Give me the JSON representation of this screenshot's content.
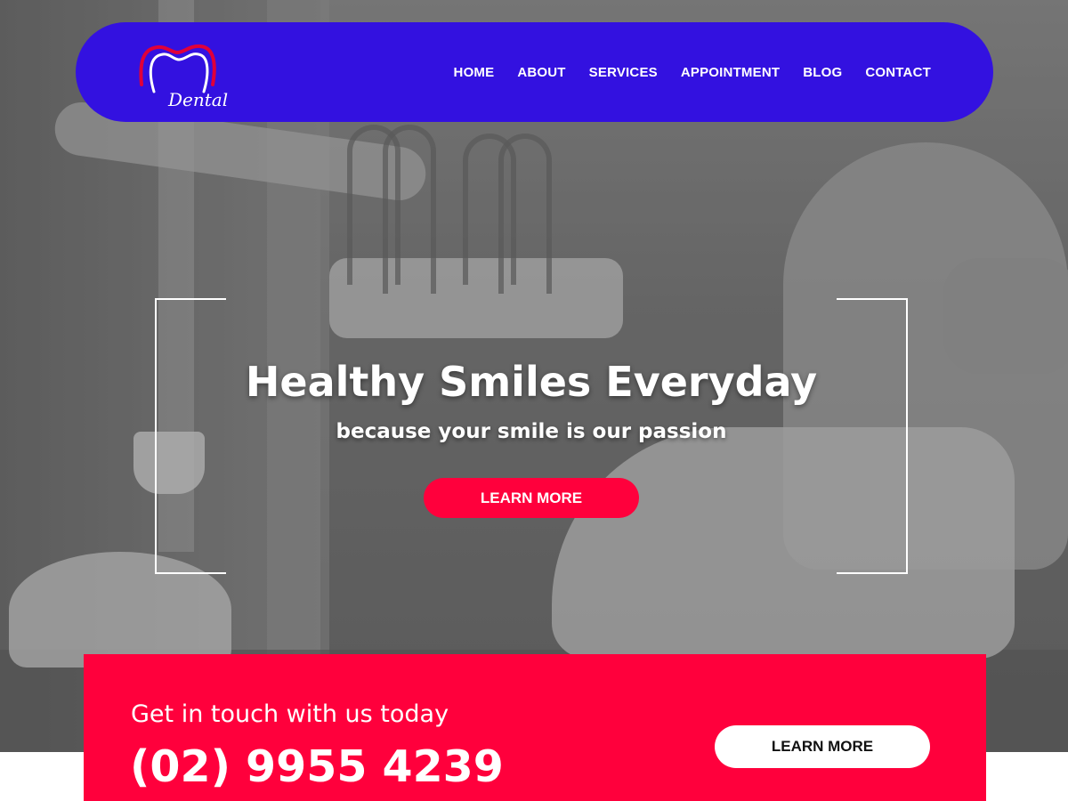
{
  "brand": {
    "logo_text": "Dental",
    "colors": {
      "nav_bg": "#3311e0",
      "accent": "#ff003c",
      "logo_red": "#e0003a",
      "white": "#ffffff"
    }
  },
  "nav": {
    "items": [
      {
        "label": "HOME"
      },
      {
        "label": "ABOUT"
      },
      {
        "label": "SERVICES"
      },
      {
        "label": "APPOINTMENT"
      },
      {
        "label": "BLOG"
      },
      {
        "label": "CONTACT"
      }
    ]
  },
  "hero": {
    "title": "Healthy Smiles Everyday",
    "subtitle": "because your smile is our passion",
    "cta_label": "LEARN MORE"
  },
  "contact": {
    "heading": "Get in touch with us today",
    "phone": "(02) 9955 4239",
    "cta_label": "LEARN MORE"
  }
}
